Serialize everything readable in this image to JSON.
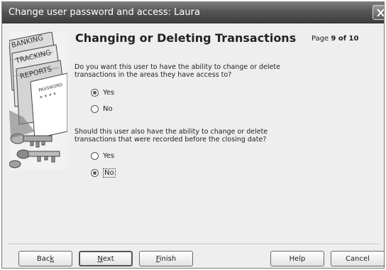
{
  "window": {
    "title": "Change user password and access: Laura"
  },
  "heading": "Changing or Deleting Transactions",
  "page": {
    "prefix": "Page",
    "current_of_total": "9 of 10"
  },
  "image_words": [
    "BANKING",
    "TRACKING",
    "REPORTS",
    "PASSWORD",
    "* * * *"
  ],
  "question1": {
    "text": "Do you want this user to have the ability to change or delete transactions in the areas they have access to?",
    "options": [
      {
        "label": "Yes",
        "selected": true
      },
      {
        "label": "No",
        "selected": false
      }
    ]
  },
  "question2": {
    "text": "Should this user also have the ability to change or delete transactions that were recorded before the closing date?",
    "options": [
      {
        "label": "Yes",
        "selected": false
      },
      {
        "label": "No",
        "selected": true
      }
    ]
  },
  "buttons": {
    "back": {
      "pre": "Bac",
      "accel": "k",
      "post": ""
    },
    "next": {
      "pre": "",
      "accel": "N",
      "post": "ext"
    },
    "finish": {
      "pre": "",
      "accel": "F",
      "post": "inish"
    },
    "help": "Help",
    "cancel": "Cancel"
  },
  "colors": {
    "titlebar": "#555555",
    "dialog_bg": "#eeeeee",
    "text": "#222222"
  }
}
